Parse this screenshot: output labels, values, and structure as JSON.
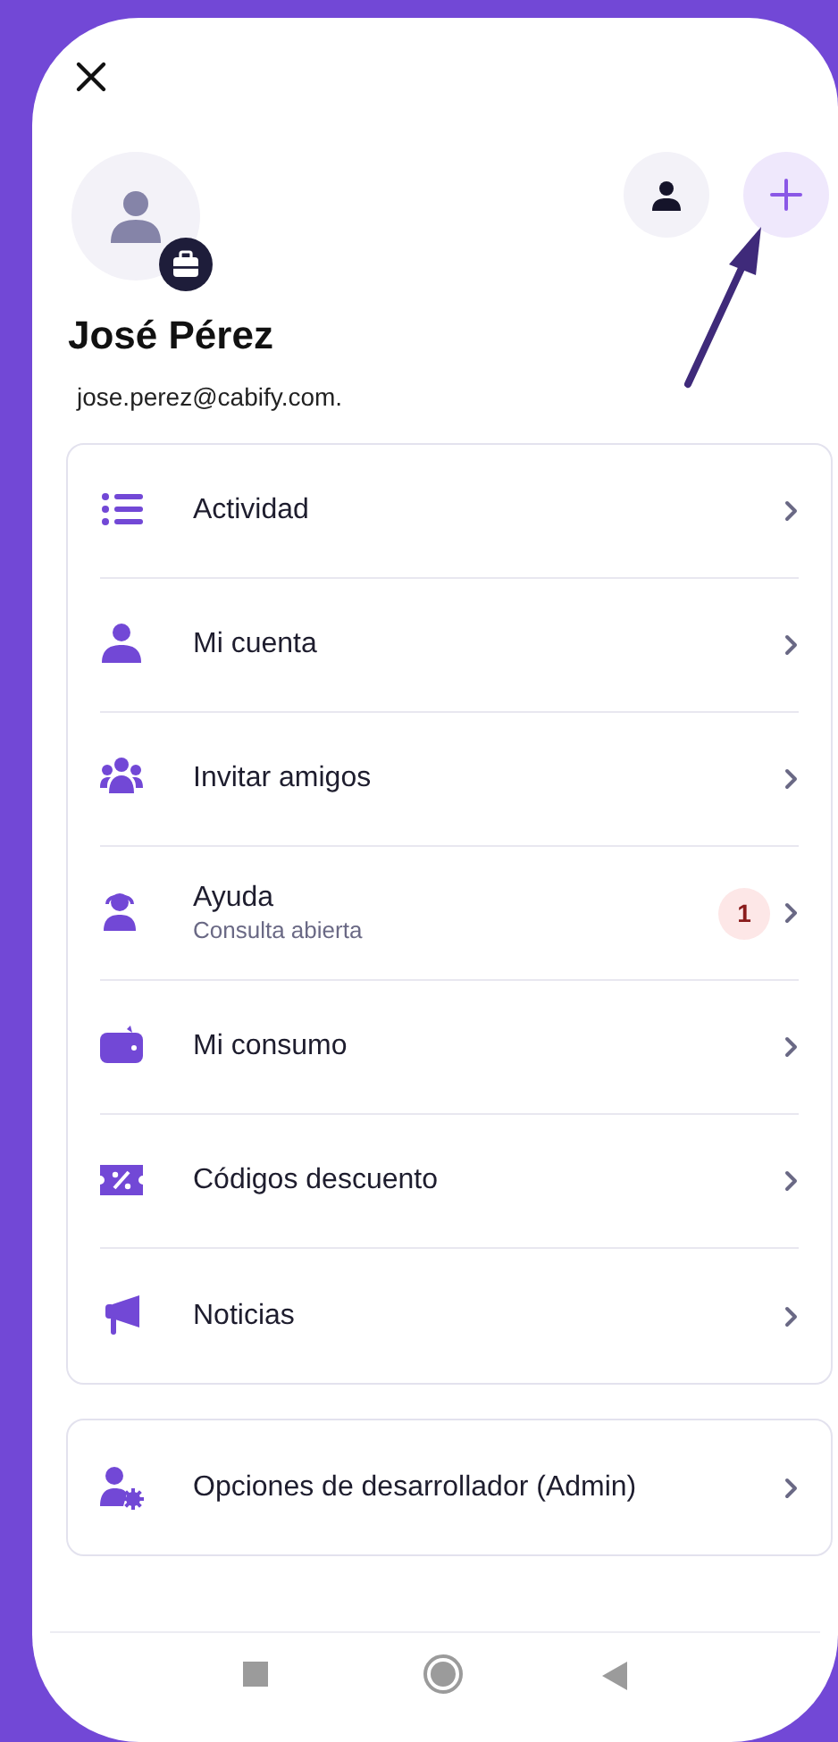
{
  "profile": {
    "name": "José Pérez",
    "email": "jose.perez@cabify.com."
  },
  "menu": [
    {
      "kind": "list",
      "label": "Actividad"
    },
    {
      "kind": "person",
      "label": "Mi cuenta"
    },
    {
      "kind": "group",
      "label": "Invitar amigos"
    },
    {
      "kind": "support",
      "label": "Ayuda",
      "subtitle": "Consulta abierta",
      "badge": "1"
    },
    {
      "kind": "wallet",
      "label": "Mi consumo"
    },
    {
      "kind": "coupon",
      "label": "Códigos descuento"
    },
    {
      "kind": "megaphone",
      "label": "Noticias"
    }
  ],
  "admin_menu": [
    {
      "kind": "admin",
      "label": "Opciones de desarrollador (Admin)"
    }
  ]
}
